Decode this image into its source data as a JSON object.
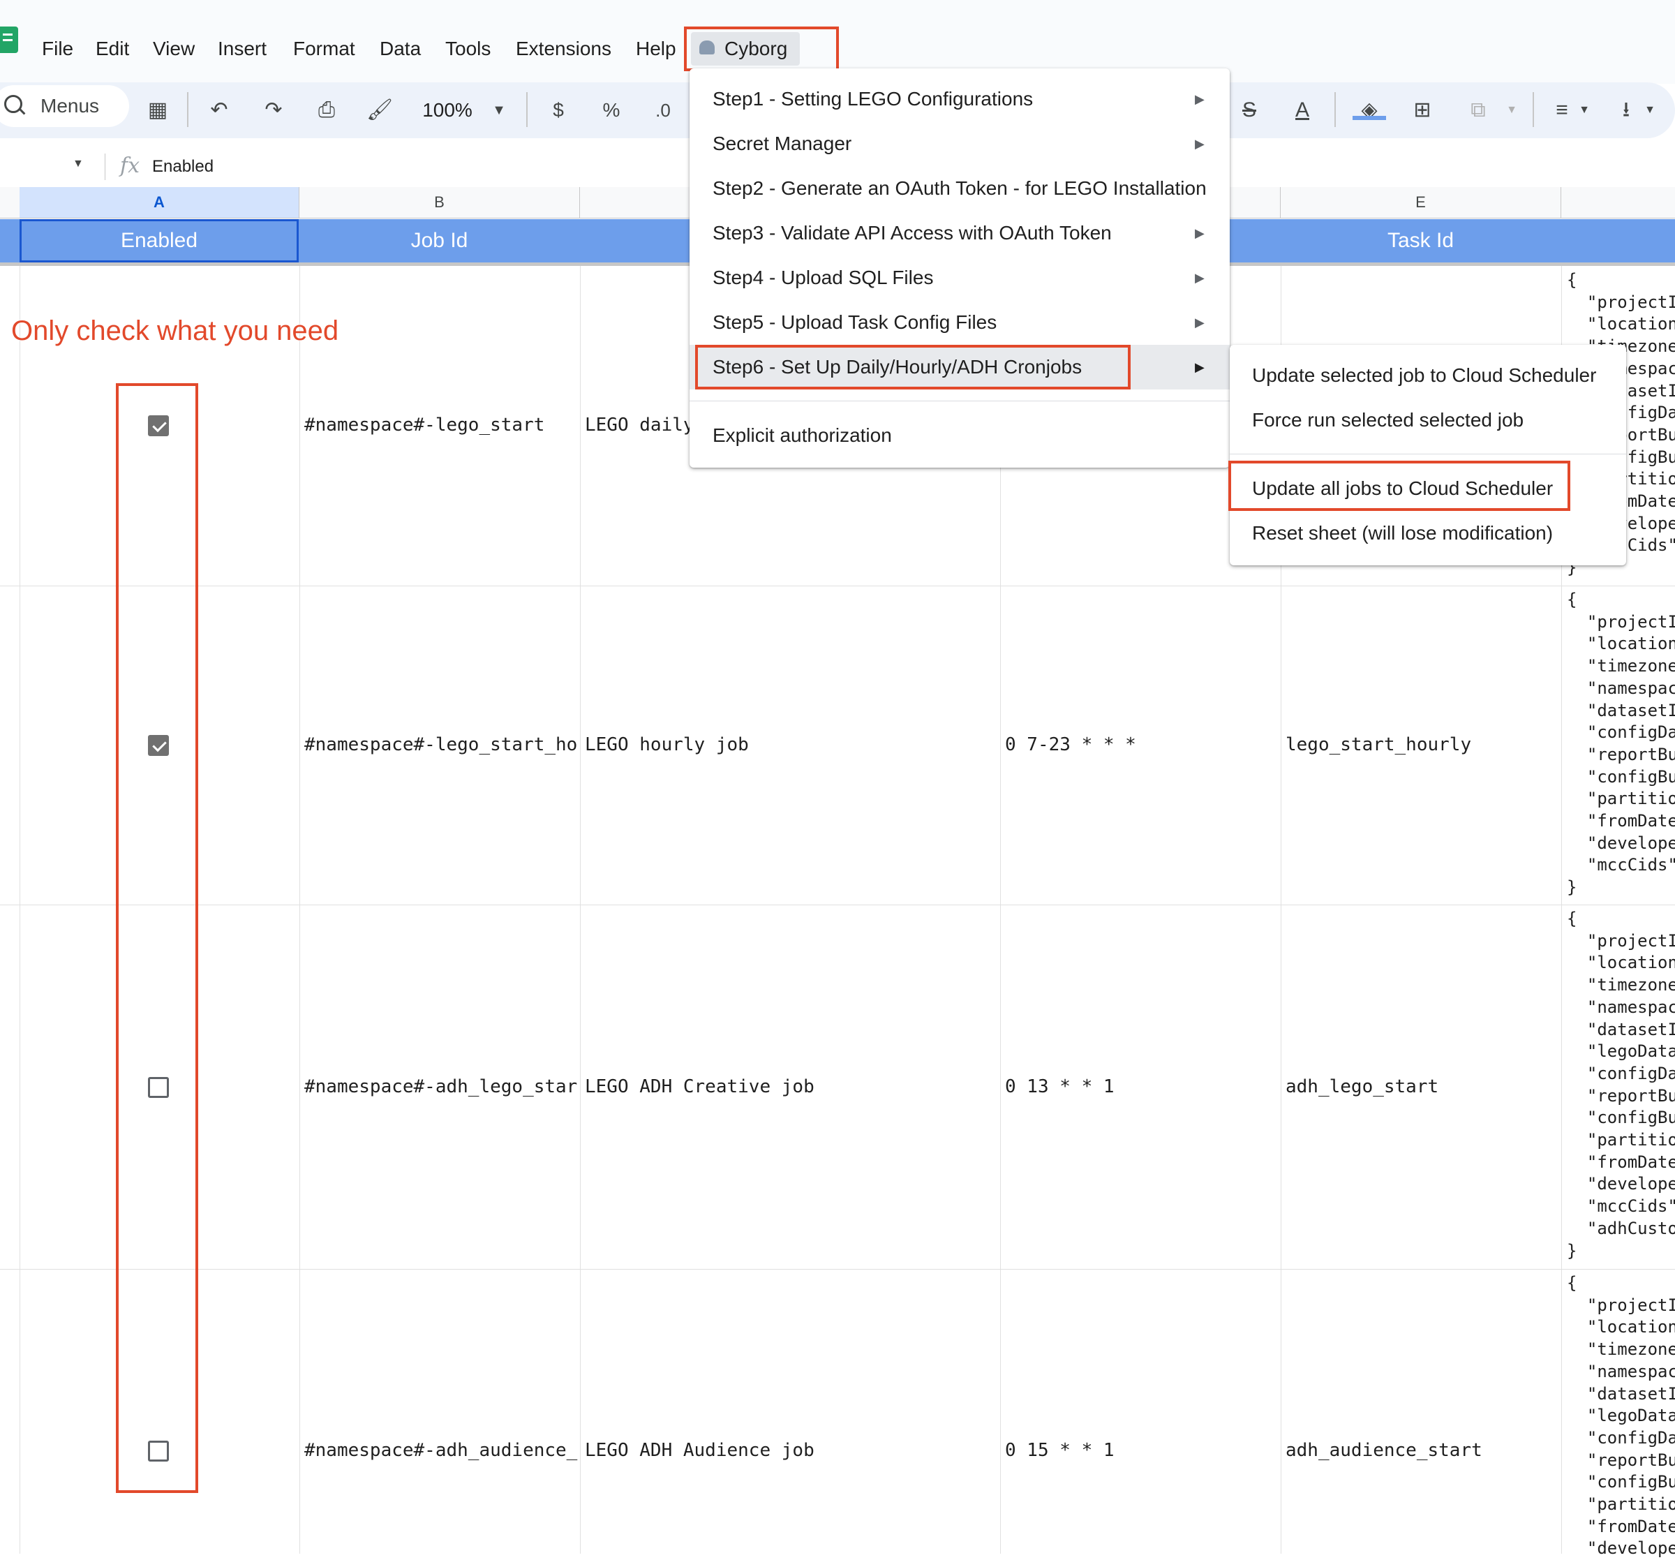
{
  "menu": {
    "file": "File",
    "edit": "Edit",
    "view": "View",
    "insert": "Insert",
    "format": "Format",
    "data": "Data",
    "tools": "Tools",
    "extensions": "Extensions",
    "help": "Help",
    "cyborg": "Cyborg"
  },
  "toolbar": {
    "search_label": "Menus",
    "zoom": "100%",
    "currency": "$",
    "percent": "%",
    "decrease_decimal": ".0"
  },
  "formula_bar": {
    "fx": "fx",
    "value": "Enabled"
  },
  "columns": [
    "A",
    "B",
    "E"
  ],
  "header_row": {
    "enabled": "Enabled",
    "job_id": "Job Id",
    "task_id": "Task Id"
  },
  "annotation": "Only check what you need",
  "rows": [
    {
      "checked": true,
      "job_id": "#namespace#-lego_start",
      "description": "LEGO daily",
      "schedule": "",
      "task_id": ""
    },
    {
      "checked": true,
      "job_id": "#namespace#-lego_start_hour",
      "description": "LEGO hourly job",
      "schedule": "0 7-23 * * *",
      "task_id": "lego_start_hourly"
    },
    {
      "checked": false,
      "job_id": "#namespace#-adh_lego_start",
      "description": "LEGO ADH Creative job",
      "schedule": "0 13 * * 1",
      "task_id": "adh_lego_start"
    },
    {
      "checked": false,
      "job_id": "#namespace#-adh_audience_st",
      "description": "LEGO ADH Audience job",
      "schedule": "0 15 * * 1",
      "task_id": "adh_audience_start"
    }
  ],
  "json_blocks": [
    "{\n  \"projectI\n  \"location\n  \"timezone\n  \"namespac\n  \"datasetI\n  \"configDa\n  \"reportBu\n  \"configBu\n  \"partitio\n  \"fromDate\n  \"develope\n  \"mccCids\"\n}",
    "{\n  \"projectI\n  \"location\n  \"timezone\n  \"namespac\n  \"datasetI\n  \"configDa\n  \"reportBu\n  \"configBu\n  \"partitio\n  \"fromDate\n  \"develope\n  \"mccCids\"\n}",
    "{\n  \"projectI\n  \"location\n  \"timezone\n  \"namespac\n  \"datasetI\n  \"legoData\n  \"configDa\n  \"reportBu\n  \"configBu\n  \"partitio\n  \"fromDate\n  \"develope\n  \"mccCids\"\n  \"adhCusto\n}",
    "{\n  \"projectI\n  \"location\n  \"timezone\n  \"namespac\n  \"datasetI\n  \"legoData\n  \"configDa\n  \"reportBu\n  \"configBu\n  \"partitio\n  \"fromDate\n  \"develope"
  ],
  "cyborg_menu": [
    {
      "label": "Step1 - Setting LEGO Configurations",
      "has_submenu": true
    },
    {
      "label": "Secret Manager",
      "has_submenu": true
    },
    {
      "label": "Step2 - Generate an OAuth Token - for LEGO Installation",
      "has_submenu": false
    },
    {
      "label": "Step3 - Validate API Access with OAuth Token",
      "has_submenu": true
    },
    {
      "label": "Step4 - Upload SQL Files",
      "has_submenu": true
    },
    {
      "label": "Step5 - Upload Task Config Files",
      "has_submenu": true
    },
    {
      "label": "Step6 - Set Up Daily/Hourly/ADH Cronjobs",
      "has_submenu": true
    },
    {
      "label": "Explicit authorization",
      "has_submenu": false
    }
  ],
  "submenu": [
    "Update selected job to Cloud Scheduler",
    "Force run selected selected job",
    "Update all jobs to Cloud Scheduler",
    "Reset sheet (will lose modification)"
  ],
  "colors": {
    "header_blue": "#6d9eeb",
    "highlight_red": "#e2492b",
    "annotation_red": "#e2492b"
  }
}
